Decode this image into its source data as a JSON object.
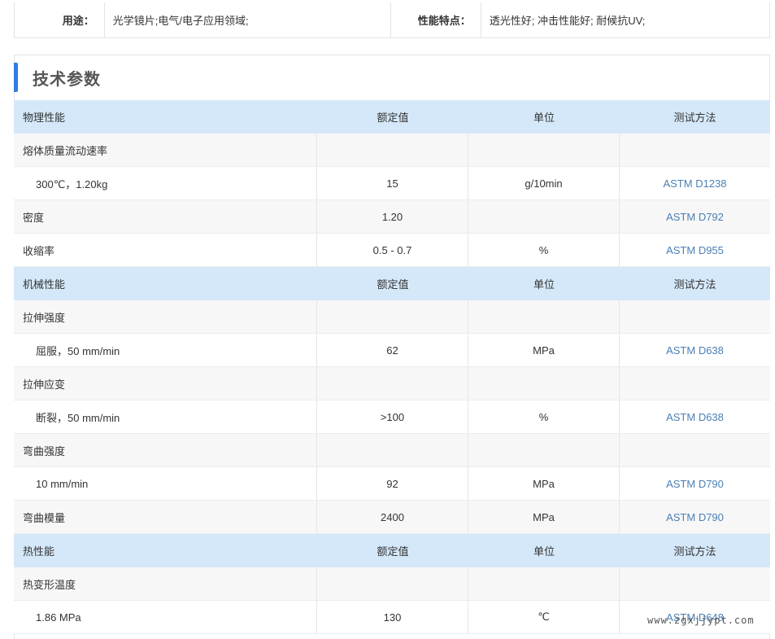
{
  "usage": {
    "label": "用途：",
    "value": "光学镜片;电气/电子应用领域;",
    "features_label": "性能特点：",
    "features_value": "透光性好; 冲击性能好; 耐候抗UV;"
  },
  "section_title": "技术参数",
  "groups": [
    {
      "header": {
        "name": "物理性能",
        "value": "额定值",
        "unit": "单位",
        "method": "测试方法"
      },
      "rows": [
        {
          "name": "熔体质量流动速率",
          "value": "",
          "unit": "",
          "method": "",
          "indent": false
        },
        {
          "name": "300℃，1.20kg",
          "value": "15",
          "unit": "g/10min",
          "method": "ASTM D1238",
          "indent": true
        },
        {
          "name": "密度",
          "value": "1.20",
          "unit": "",
          "method": "ASTM D792",
          "indent": false
        },
        {
          "name": "收缩率",
          "value": "0.5 - 0.7",
          "unit": "%",
          "method": "ASTM D955",
          "indent": false
        }
      ]
    },
    {
      "header": {
        "name": "机械性能",
        "value": "额定值",
        "unit": "单位",
        "method": "测试方法"
      },
      "rows": [
        {
          "name": "拉伸强度",
          "value": "",
          "unit": "",
          "method": "",
          "indent": false
        },
        {
          "name": "屈服，50 mm/min",
          "value": "62",
          "unit": "MPa",
          "method": "ASTM D638",
          "indent": true
        },
        {
          "name": "拉伸应变",
          "value": "",
          "unit": "",
          "method": "",
          "indent": false
        },
        {
          "name": "断裂，50 mm/min",
          "value": ">100",
          "unit": "%",
          "method": "ASTM D638",
          "indent": true
        },
        {
          "name": "弯曲强度",
          "value": "",
          "unit": "",
          "method": "",
          "indent": false
        },
        {
          "name": "10 mm/min",
          "value": "92",
          "unit": "MPa",
          "method": "ASTM D790",
          "indent": true
        },
        {
          "name": "弯曲模量",
          "value": "2400",
          "unit": "MPa",
          "method": "ASTM D790",
          "indent": false
        }
      ]
    },
    {
      "header": {
        "name": "热性能",
        "value": "额定值",
        "unit": "单位",
        "method": "测试方法"
      },
      "rows": [
        {
          "name": "热变形温度",
          "value": "",
          "unit": "",
          "method": "",
          "indent": false
        },
        {
          "name": "1.86 MPa",
          "value": "130",
          "unit": "℃",
          "method": "ASTM D648",
          "indent": true
        }
      ]
    }
  ],
  "watermark": "www.zgxjjypt.com",
  "colors": {
    "accent": "#2c7fe0",
    "header_bg": "#d5e8f9",
    "link": "#4a7fb3",
    "alt_row": "#f7f7f7"
  }
}
